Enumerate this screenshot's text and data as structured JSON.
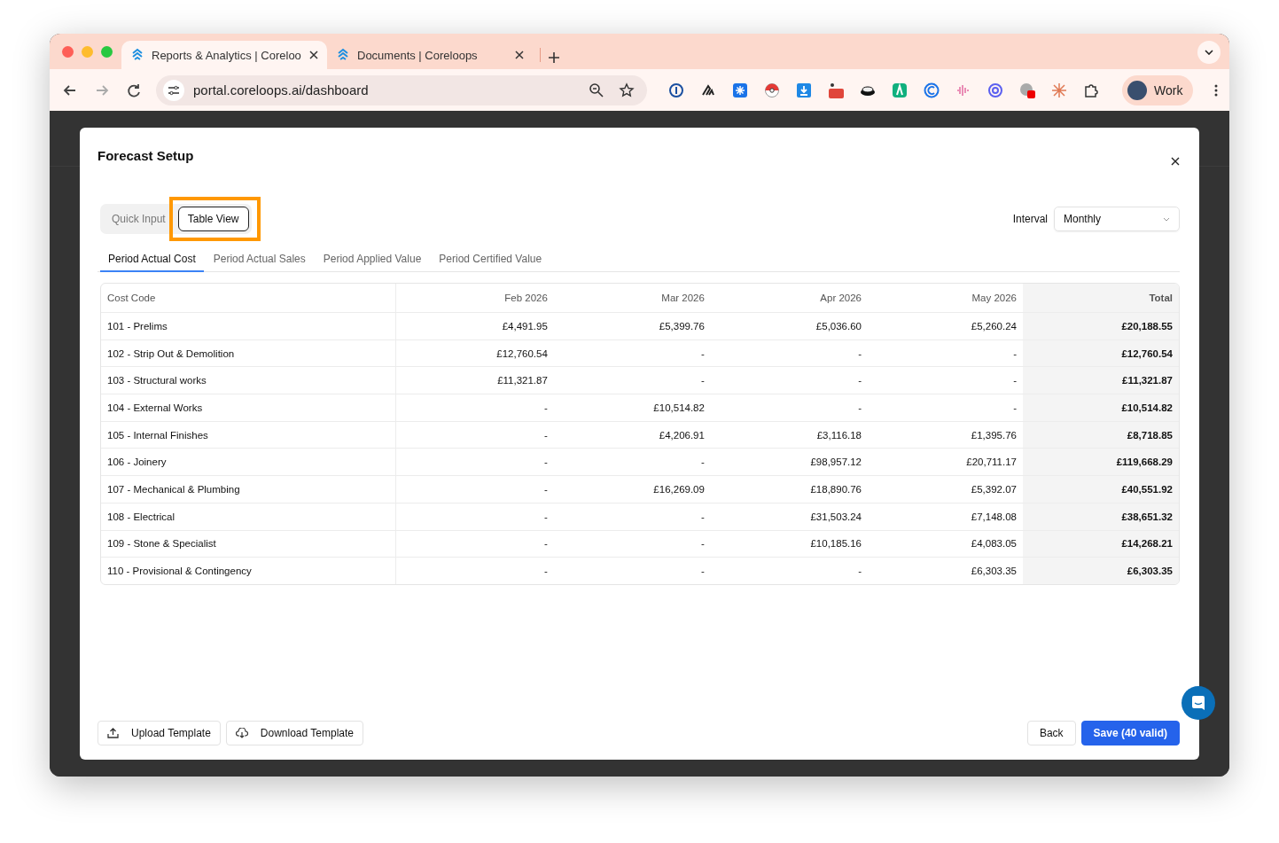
{
  "browser": {
    "tabs": [
      {
        "title": "Reports & Analytics | Coreloo",
        "selected": true
      },
      {
        "title": "Documents | Coreloops",
        "selected": false
      }
    ],
    "address": "portal.coreloops.ai/dashboard",
    "profile": "Work"
  },
  "modal": {
    "title": "Forecast Setup",
    "view_toggle": [
      {
        "label": "Quick Input",
        "selected": false,
        "highlighted": false
      },
      {
        "label": "Table View",
        "selected": true,
        "highlighted": true
      }
    ],
    "interval": {
      "label": "Interval",
      "value": "Monthly"
    },
    "metric_tabs": [
      {
        "label": "Period Actual Cost",
        "selected": true
      },
      {
        "label": "Period Actual Sales",
        "selected": false
      },
      {
        "label": "Period Applied Value",
        "selected": false
      },
      {
        "label": "Period Certified Value",
        "selected": false
      }
    ],
    "table": {
      "columns": [
        "Cost Code",
        "Feb 2026",
        "Mar 2026",
        "Apr 2026",
        "May 2026",
        "Total"
      ],
      "rows": [
        [
          "101 - Prelims",
          "£4,491.95",
          "£5,399.76",
          "£5,036.60",
          "£5,260.24",
          "£20,188.55"
        ],
        [
          "102 - Strip Out & Demolition",
          "£12,760.54",
          "-",
          "-",
          "-",
          "£12,760.54"
        ],
        [
          "103 - Structural works",
          "£11,321.87",
          "-",
          "-",
          "-",
          "£11,321.87"
        ],
        [
          "104 - External Works",
          "-",
          "£10,514.82",
          "-",
          "-",
          "£10,514.82"
        ],
        [
          "105 - Internal Finishes",
          "-",
          "£4,206.91",
          "£3,116.18",
          "£1,395.76",
          "£8,718.85"
        ],
        [
          "106 - Joinery",
          "-",
          "-",
          "£98,957.12",
          "£20,711.17",
          "£119,668.29"
        ],
        [
          "107 - Mechanical & Plumbing",
          "-",
          "£16,269.09",
          "£18,890.76",
          "£5,392.07",
          "£40,551.92"
        ],
        [
          "108 - Electrical",
          "-",
          "-",
          "£31,503.24",
          "£7,148.08",
          "£38,651.32"
        ],
        [
          "109 - Stone & Specialist",
          "-",
          "-",
          "£10,185.16",
          "£4,083.05",
          "£14,268.21"
        ],
        [
          "110 - Provisional & Contingency",
          "-",
          "-",
          "-",
          "£6,303.35",
          "£6,303.35"
        ]
      ]
    },
    "footer": {
      "upload": "Upload Template",
      "download": "Download Template",
      "back": "Back",
      "save": "Save (40 valid)"
    }
  }
}
